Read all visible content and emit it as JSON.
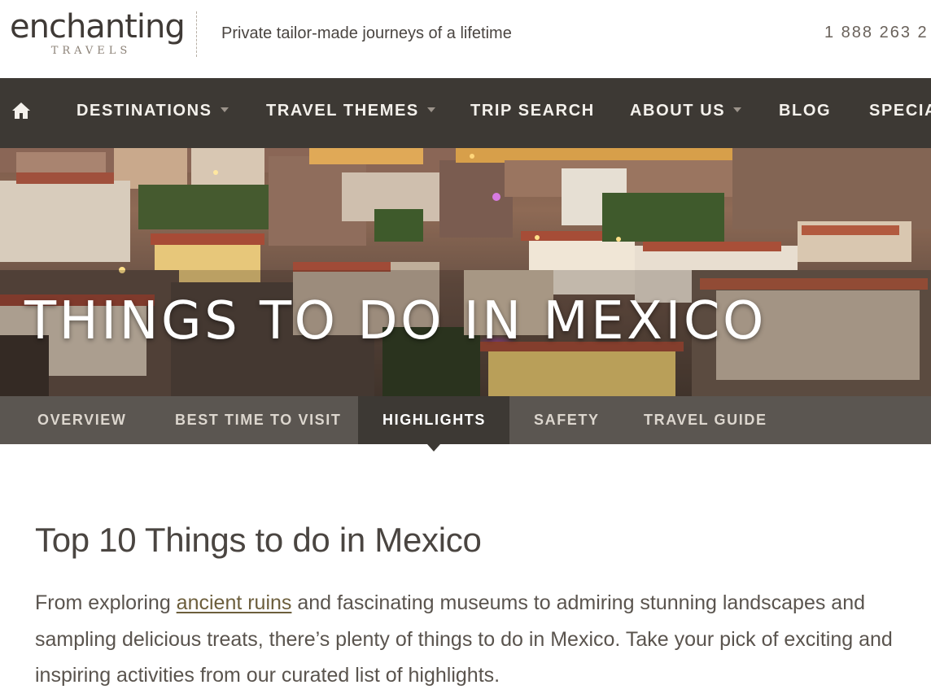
{
  "header": {
    "logo_main": "enchanting",
    "logo_sub": "TRAVELS",
    "tagline": "Private tailor-made journeys of a lifetime",
    "phone": "1 888 263 2"
  },
  "nav": {
    "home_icon": "home-icon",
    "items": [
      {
        "label": "DESTINATIONS",
        "dropdown": true
      },
      {
        "label": "TRAVEL THEMES",
        "dropdown": true
      },
      {
        "label": "TRIP SEARCH",
        "dropdown": false
      },
      {
        "label": "ABOUT US",
        "dropdown": true
      },
      {
        "label": "BLOG",
        "dropdown": false
      },
      {
        "label": "SPECIA",
        "dropdown": false
      }
    ]
  },
  "hero": {
    "title": "THINGS TO DO IN MEXICO"
  },
  "subnav": {
    "items": [
      {
        "label": "OVERVIEW"
      },
      {
        "label": "BEST TIME TO VISIT"
      },
      {
        "label": "HIGHLIGHTS",
        "active": true
      },
      {
        "label": "SAFETY"
      },
      {
        "label": "TRAVEL GUIDE"
      }
    ]
  },
  "content": {
    "title": "Top 10 Things to do in Mexico",
    "intro_1_before": "From exploring ",
    "intro_1_link": "ancient ruins",
    "intro_1_after": " and fascinating museums to admiring stunning landscapes and",
    "intro_2": "sampling delicious treats, there’s plenty of things to do in Mexico. Take your pick of exciting and",
    "intro_3": "inspiring activities from our curated list of highlights."
  },
  "colors": {
    "nav_bg": "#3d3934",
    "subnav_bg": "#5b5651",
    "link": "#6c5e3c",
    "text": "#4a4541"
  }
}
